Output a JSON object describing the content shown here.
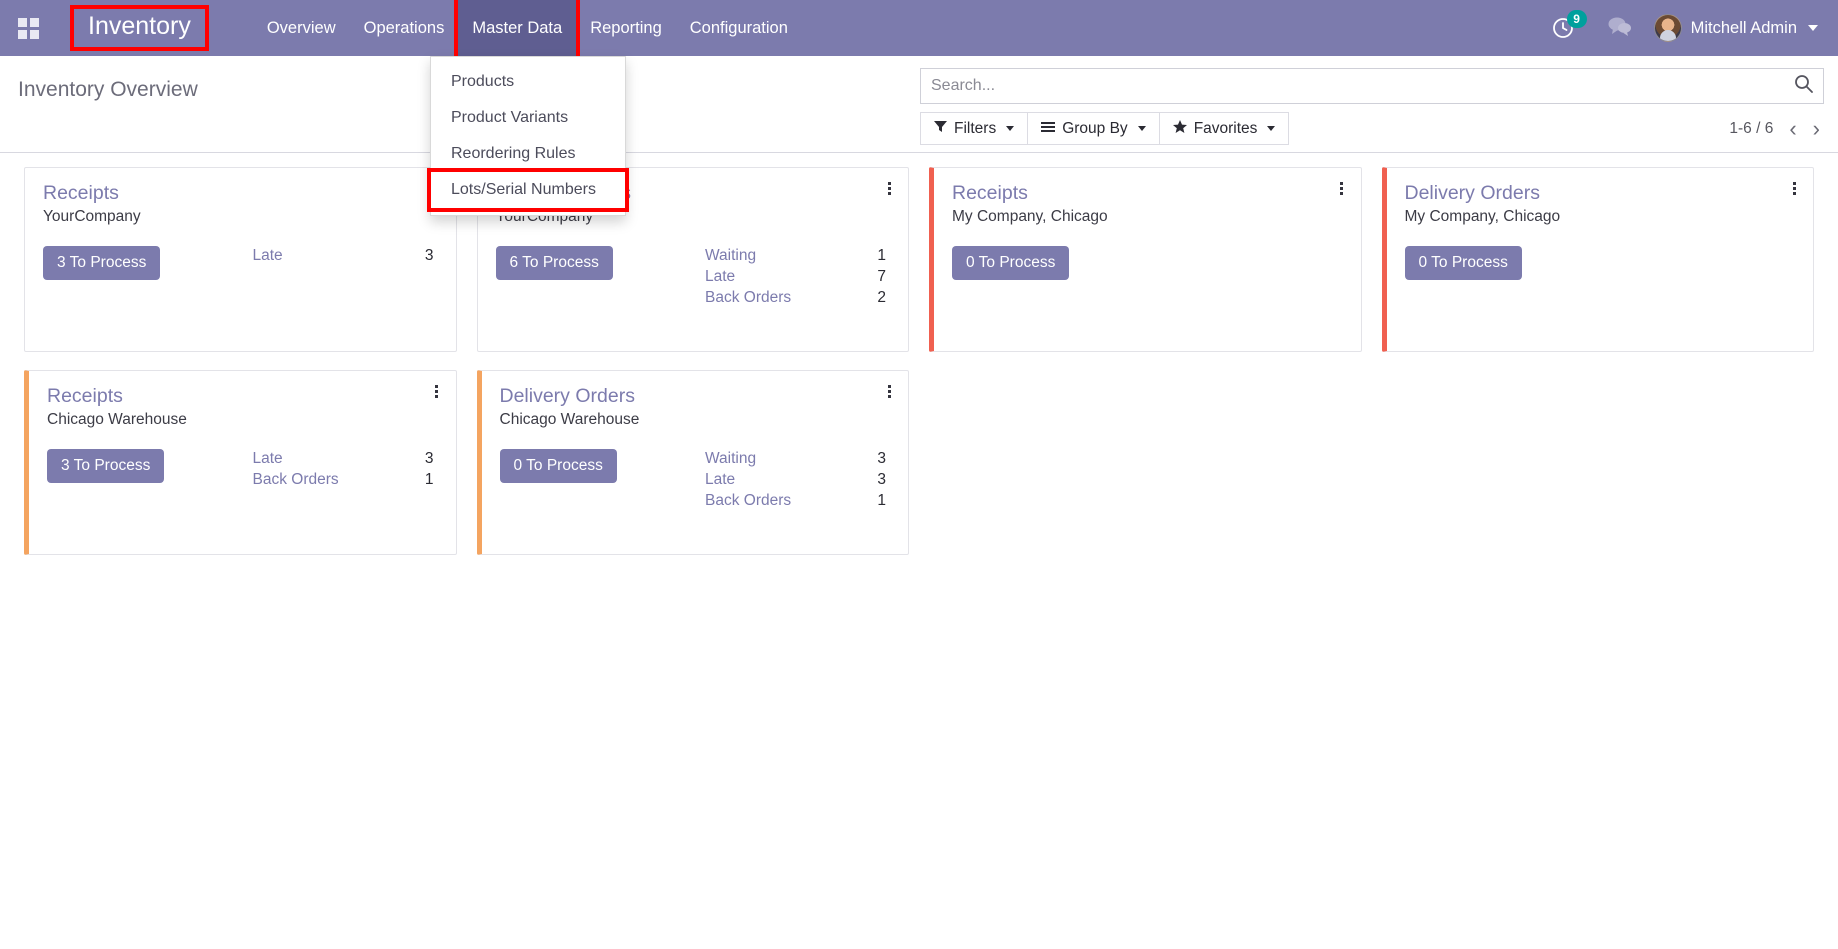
{
  "navbar": {
    "apps_icon": "apps-grid-icon",
    "brand": "Inventory",
    "menu": [
      {
        "label": "Overview",
        "active": false
      },
      {
        "label": "Operations",
        "active": false
      },
      {
        "label": "Master Data",
        "active": true
      },
      {
        "label": "Reporting",
        "active": false
      },
      {
        "label": "Configuration",
        "active": false
      }
    ],
    "activity_count": "9",
    "user_name": "Mitchell Admin",
    "accent_color": "#7C7BAD",
    "active_menu_color": "#5F5E91",
    "badge_color": "#00A09D"
  },
  "dropdown": {
    "parent": "Master Data",
    "items": [
      {
        "label": "Products",
        "highlighted": false
      },
      {
        "label": "Product Variants",
        "highlighted": false
      },
      {
        "label": "Reordering Rules",
        "highlighted": false
      },
      {
        "label": "Lots/Serial Numbers",
        "highlighted": true
      }
    ]
  },
  "highlight_color": "#FF0000",
  "control_panel": {
    "page_title": "Inventory Overview",
    "search": {
      "value": "",
      "placeholder": "Search..."
    },
    "buttons": [
      {
        "label": "Filters",
        "icon": "filter-icon"
      },
      {
        "label": "Group By",
        "icon": "group-by-icon"
      },
      {
        "label": "Favorites",
        "icon": "star-icon"
      }
    ],
    "pager": {
      "range": "1-6 / 6",
      "prev": "‹",
      "next": "›"
    }
  },
  "cards": [
    {
      "title": "Receipts",
      "subtitle": "YourCompany",
      "button": "3 To Process",
      "accent": "none",
      "stats": [
        {
          "label": "Late",
          "value": "3"
        }
      ]
    },
    {
      "title": "Delivery Orders",
      "subtitle": "YourCompany",
      "button": "6 To Process",
      "accent": "none",
      "stats": [
        {
          "label": "Waiting",
          "value": "1"
        },
        {
          "label": "Late",
          "value": "7"
        },
        {
          "label": "Back Orders",
          "value": "2"
        }
      ]
    },
    {
      "title": "Receipts",
      "subtitle": "My Company, Chicago",
      "button": "0 To Process",
      "accent": "red",
      "stats": []
    },
    {
      "title": "Delivery Orders",
      "subtitle": "My Company, Chicago",
      "button": "0 To Process",
      "accent": "red",
      "stats": []
    },
    {
      "title": "Receipts",
      "subtitle": "Chicago Warehouse",
      "button": "3 To Process",
      "accent": "orange",
      "stats": [
        {
          "label": "Late",
          "value": "3"
        },
        {
          "label": "Back Orders",
          "value": "1"
        }
      ]
    },
    {
      "title": "Delivery Orders",
      "subtitle": "Chicago Warehouse",
      "button": "0 To Process",
      "accent": "orange",
      "stats": [
        {
          "label": "Waiting",
          "value": "3"
        },
        {
          "label": "Late",
          "value": "3"
        },
        {
          "label": "Back Orders",
          "value": "1"
        }
      ]
    }
  ],
  "colors": {
    "accent_red": "#F06050",
    "accent_orange": "#F4A460",
    "primary": "#7C7BAD"
  }
}
